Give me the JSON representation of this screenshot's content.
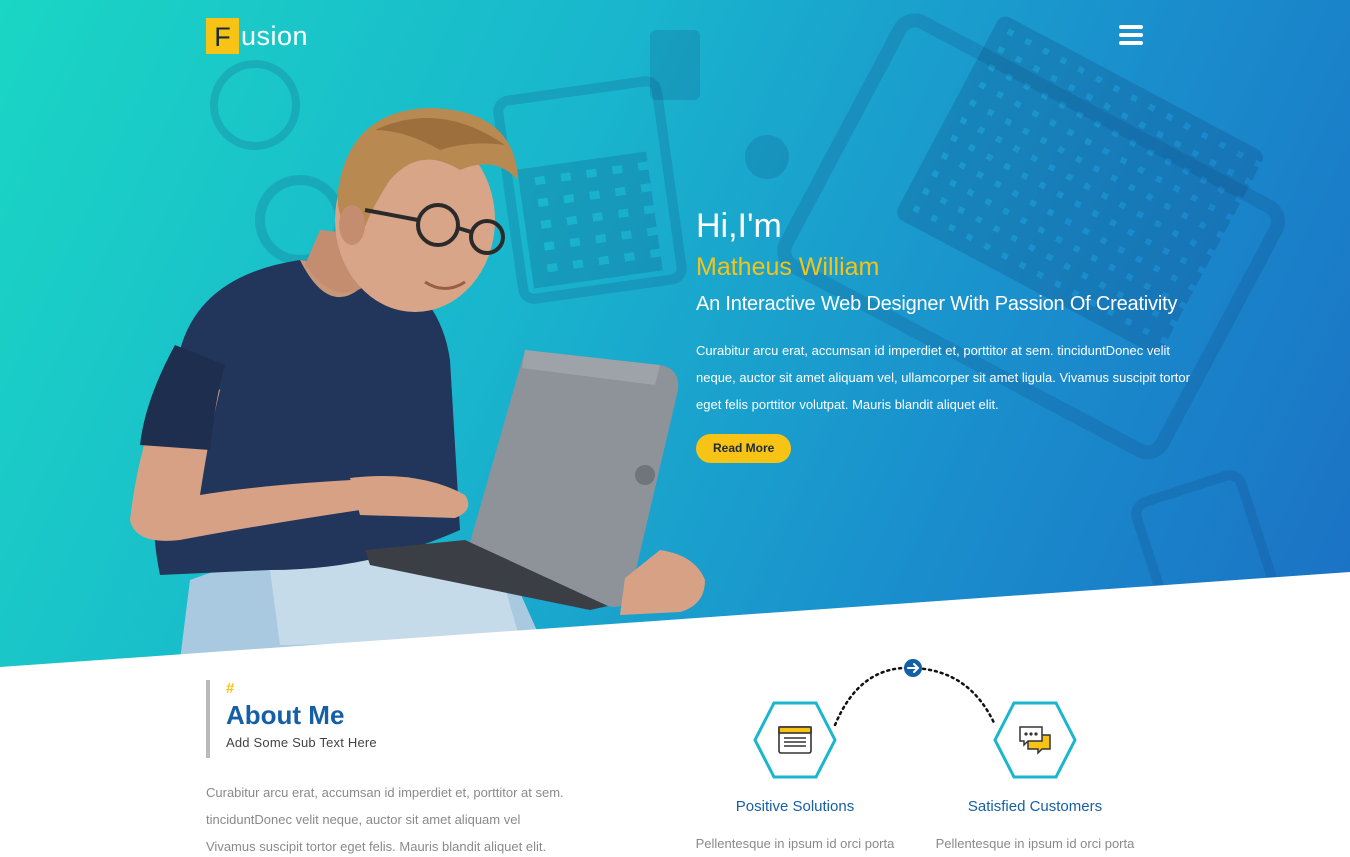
{
  "header": {
    "logo_letter": "F",
    "logo_rest": "usion",
    "menu_icon": "hamburger-menu-icon"
  },
  "hero": {
    "greeting": "Hi,I'm",
    "name": "Matheus William",
    "tagline": "An Interactive Web Designer With Passion Of Creativity",
    "description": "Curabitur arcu erat, accumsan id imperdiet et, porttitor at sem. tinciduntDonec velit neque, auctor sit amet aliquam vel, ullamcorper sit amet ligula. Vivamus suscipit tortor eget felis porttitor volutpat. Mauris blandit aliquet elit.",
    "read_more_label": "Read More"
  },
  "about": {
    "hash": "#",
    "title": "About Me",
    "subtitle": "Add Some Sub Text Here",
    "text_line1": "Curabitur arcu erat, accumsan id imperdiet et, porttitor at sem.",
    "text_line2": "tinciduntDonec velit neque, auctor sit amet aliquam vel",
    "text_line3": "Vivamus suscipit tortor eget felis. Mauris blandit aliquet elit."
  },
  "features": [
    {
      "icon": "browser-window-icon",
      "title": "Positive Solutions",
      "text": "Pellentesque in ipsum id orci porta"
    },
    {
      "icon": "chat-bubbles-icon",
      "title": "Satisfied Customers",
      "text": "Pellentesque in ipsum id orci porta"
    }
  ],
  "colors": {
    "accent_yellow": "#f7c315",
    "brand_blue": "#155fa6",
    "hero_gradient_start": "#1ad6c4",
    "hero_gradient_end": "#1b70c4",
    "hex_border": "#19b6cd"
  }
}
